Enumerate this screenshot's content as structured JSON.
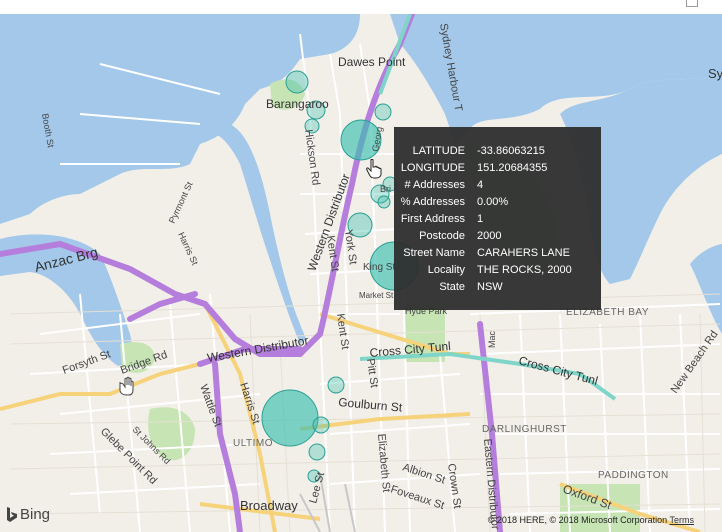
{
  "map": {
    "labels": {
      "dawes_point": "Dawes Point",
      "barangaroo": "Barangaroo",
      "sydney_harbour": "Sydney Harbour T",
      "anzac_brg": "Anzac Brg",
      "western_distributor_a": "Western Distributor",
      "western_distributor_b": "Western Distributor",
      "cross_city_tunl_a": "Cross City Tunl",
      "cross_city_tunl_b": "Cross City Tunl",
      "goulburn_st": "Goulburn St",
      "broadway": "Broadway",
      "ultimo": "ULTIMO",
      "darlinghurst": "DARLINGHURST",
      "paddington": "PADDINGTON",
      "elizabeth_bay": "ELIZABETH BAY",
      "forsyth_st": "Forsyth St",
      "bridge_rd": "Bridge Rd",
      "wattle_st": "Wattle St",
      "harris_st": "Harris St",
      "kent_st": "Kent St",
      "york_st": "York St",
      "pitt_st": "Pitt St",
      "elizabeth_st": "Elizabeth St",
      "eastern_distributor": "Eastern Distributor",
      "oxford_st": "Oxford St",
      "foveaux_st": "Foveaux St",
      "albion_st": "Albion St",
      "crown_st": "Crown St",
      "lee_st": "Lee St",
      "hyde_park": "Hyde Park",
      "market_st": "Market St",
      "king_st": "King St",
      "hickson_rd": "Hickson Rd",
      "new_beach_rd": "New Beach Rd",
      "glebe_point_rd": "Glebe Point Rd",
      "st_johns_rd": "St Johns Rd",
      "harris_st_upper": "Harris St",
      "pyrmont_st": "Pyrmont St",
      "booth_st": "Booth St",
      "grosvenor": "Georg",
      "bri": "Bri",
      "mac": "Mac",
      "sy": "Sy"
    },
    "tooltip": {
      "rows": [
        {
          "key": "LATITUDE",
          "value": "-33.86063215"
        },
        {
          "key": "LONGITUDE",
          "value": "151.20684355"
        },
        {
          "key": "# Addresses",
          "value": "4"
        },
        {
          "key": "% Addresses",
          "value": "0.00%"
        },
        {
          "key": "First Address",
          "value": "1"
        },
        {
          "key": "Postcode",
          "value": "2000"
        },
        {
          "key": "Street Name",
          "value": "CARAHERS LANE"
        },
        {
          "key": "Locality",
          "value": "THE ROCKS, 2000"
        },
        {
          "key": "State",
          "value": "NSW"
        }
      ]
    },
    "attribution": {
      "brand": "Bing",
      "copyright": "© 2018 HERE, © 2018 Microsoft Corporation",
      "terms": "Terms"
    },
    "colors": {
      "water": "#a3c8ea",
      "land": "#f2efe9",
      "park": "#c6e4b4",
      "bubble": "#3bbfb0",
      "motorway": "#b57edc",
      "arterial": "#f6d27a"
    }
  }
}
